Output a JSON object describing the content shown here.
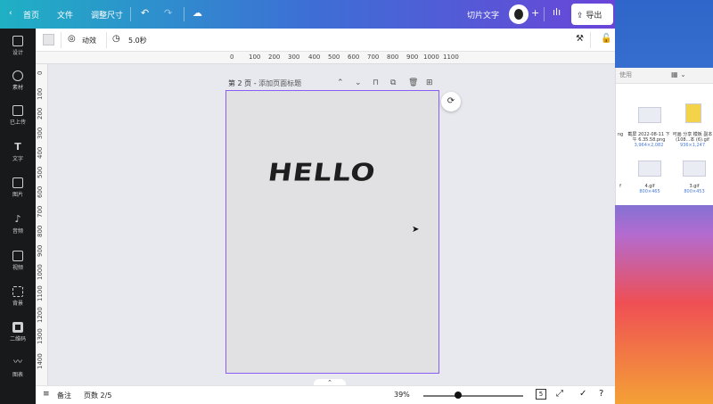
{
  "topbar": {
    "home_label": "首页",
    "file_label": "文件",
    "resize_label": "调整尺寸",
    "title_label": "切片文字",
    "export_label": "导出"
  },
  "sidebar": {
    "items": [
      {
        "label": "设计",
        "icon": "layout-icon"
      },
      {
        "label": "素材",
        "icon": "elements-icon"
      },
      {
        "label": "已上传",
        "icon": "upload-icon"
      },
      {
        "label": "文字",
        "icon": "text-icon"
      },
      {
        "label": "图片",
        "icon": "image-icon"
      },
      {
        "label": "音频",
        "icon": "music-icon"
      },
      {
        "label": "视频",
        "icon": "video-icon"
      },
      {
        "label": "背景",
        "icon": "background-icon"
      },
      {
        "label": "二维码",
        "icon": "qrcode-icon"
      },
      {
        "label": "图表",
        "icon": "chart-icon"
      }
    ]
  },
  "toolbar": {
    "animate_label": "动效",
    "duration_label": "5.0秒"
  },
  "ruler": {
    "top_ticks": [
      "0",
      "100",
      "200",
      "300",
      "400",
      "500",
      "600",
      "700",
      "800",
      "900",
      "1000",
      "1100"
    ],
    "left_ticks": [
      "0",
      "100",
      "200",
      "300",
      "400",
      "500",
      "600",
      "700",
      "800",
      "900",
      "1000",
      "1100",
      "1200",
      "1300",
      "1400"
    ]
  },
  "page": {
    "title_prefix": "第 2 页 - ",
    "title_placeholder": "添加页面标题",
    "text_content": "HELLO"
  },
  "bottombar": {
    "notes_label": "备注",
    "page_count": "页数 2/5",
    "zoom": "39%",
    "page_badge": "5",
    "zoom_fraction": 0.39
  },
  "finder": {
    "header_text": "使用",
    "files": [
      {
        "name": "截屏 2022-08-11 下午 6.35.58.png",
        "size": "3,964×2,082"
      },
      {
        "name": "可画 分享 模板 副本 (108...本 (6).gif",
        "size": "936×1,247"
      },
      {
        "name": "4.gif",
        "size": "800×465"
      },
      {
        "name": "3.gif",
        "size": "800×453"
      }
    ],
    "partial_label_1": "ng",
    "partial_label_2": "f"
  }
}
